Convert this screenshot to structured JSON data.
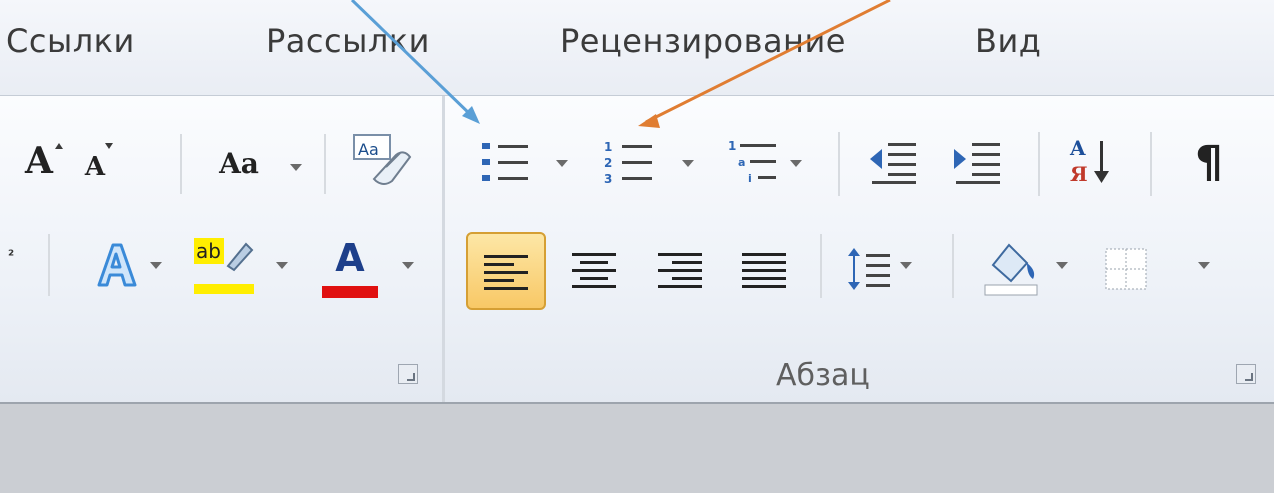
{
  "tabs": {
    "links": "Ссылки",
    "mailings": "Рассылки",
    "review": "Рецензирование",
    "view": "Вид"
  },
  "font_group": {
    "grow_font_glyph": "A",
    "shrink_font_glyph": "A",
    "change_case_glyph": "Aa",
    "clear_format_glyph": "Aa",
    "highlight_glyph": "ab",
    "font_color_glyph": "A"
  },
  "paragraph_group": {
    "label": "Абзац",
    "sort_glyph_top": "A",
    "sort_glyph_bottom": "Я",
    "pilcrow": "¶"
  },
  "colors": {
    "highlight": "#ffee00",
    "font_color": "#e01010",
    "arrow_blue": "#5a9fd6",
    "arrow_orange": "#e07d32"
  }
}
